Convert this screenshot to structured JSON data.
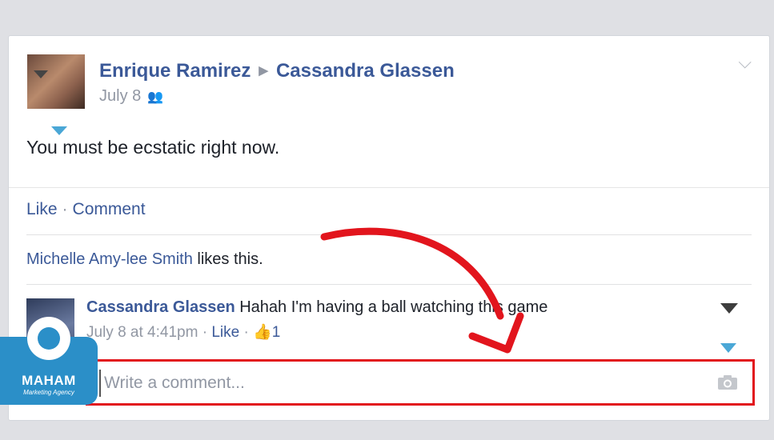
{
  "post": {
    "author": "Enrique Ramirez",
    "target": "Cassandra Glassen",
    "date": "July 8",
    "text": "You must be ecstatic right now."
  },
  "actions": {
    "like": "Like",
    "separator": "·",
    "comment": "Comment"
  },
  "likes": {
    "name": "Michelle Amy-lee Smith",
    "suffix": "likes this."
  },
  "comment": {
    "author": "Cassandra Glassen",
    "text": "Hahah I'm having a ball watching this game",
    "time": "July 8 at 4:41pm",
    "dot": "·",
    "like": "Like",
    "like_count": "1"
  },
  "comment_input": {
    "placeholder": "Write a comment..."
  },
  "watermark": {
    "name": "MAHAM",
    "tagline": "Marketing Agency"
  },
  "colors": {
    "link": "#3b5998",
    "highlight": "#e2151d",
    "accent": "#4aa7d6"
  }
}
